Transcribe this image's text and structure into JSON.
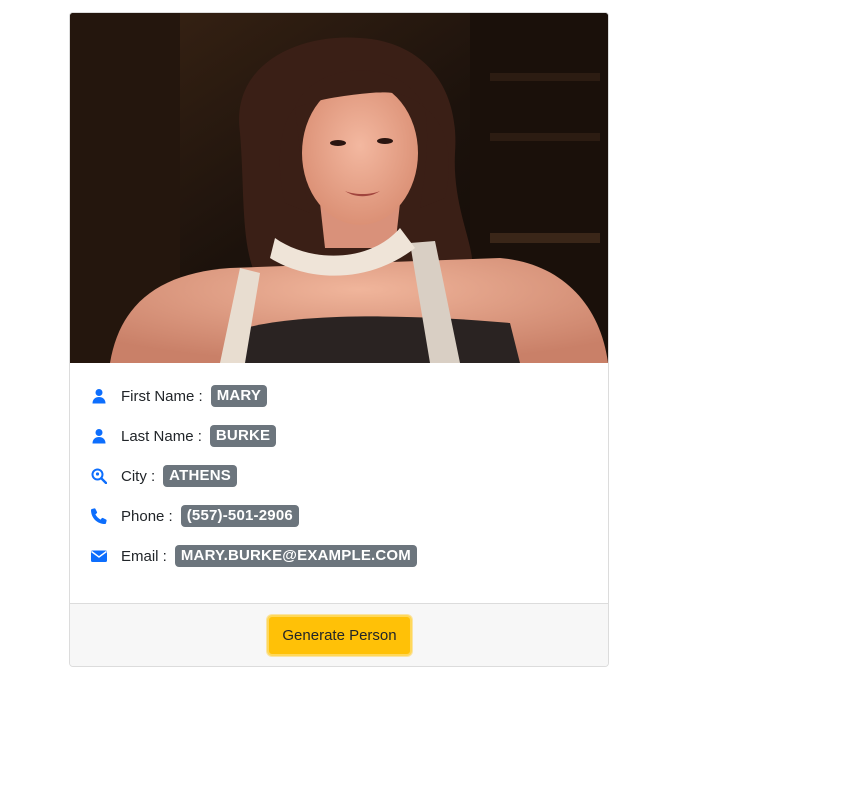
{
  "person": {
    "photo_alt": "",
    "first_name_label": "First Name :",
    "first_name": "MARY",
    "last_name_label": "Last Name :",
    "last_name": "BURKE",
    "city_label": "City :",
    "city": "ATHENS",
    "phone_label": "Phone :",
    "phone": "(557)-501-2906",
    "email_label": "Email :",
    "email": "MARY.BURKE@EXAMPLE.COM"
  },
  "footer": {
    "generate_label": "Generate Person"
  },
  "colors": {
    "icon": "#0d6efd",
    "badge": "#6c757d",
    "button": "#ffc107"
  },
  "icons": {
    "first_name": "user-icon",
    "last_name": "user-icon",
    "city": "search-location-icon",
    "phone": "phone-icon",
    "email": "envelope-icon"
  }
}
